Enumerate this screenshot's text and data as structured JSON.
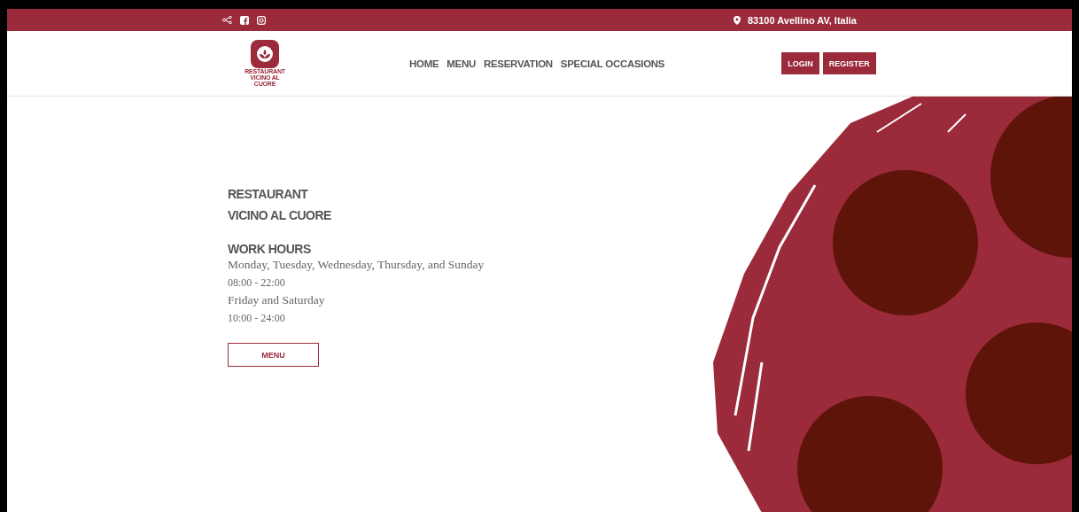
{
  "top_bar": {
    "address": "83100 Avellino AV, Italia"
  },
  "logo": {
    "lines": [
      "RESTAURANT",
      "VICINO AL",
      "CUORE"
    ]
  },
  "nav": [
    "HOME",
    "MENU",
    "RESERVATION",
    "SPECIAL OCCASIONS"
  ],
  "auth_buttons": [
    "LOGIN",
    "REGISTER"
  ],
  "hero": {
    "title_lines": [
      "RESTAURANT",
      "VICINO AL CUORE"
    ],
    "hours_heading": "WORK HOURS",
    "hours": [
      {
        "kind": "days",
        "text": "Monday, Tuesday, Wednesday, Thursday, and Sunday"
      },
      {
        "kind": "time",
        "text": "08:00 - 22:00"
      },
      {
        "kind": "days",
        "text": "Friday and Saturday"
      },
      {
        "kind": "time",
        "text": "10:00 - 24:00"
      }
    ],
    "button": "MENU"
  }
}
